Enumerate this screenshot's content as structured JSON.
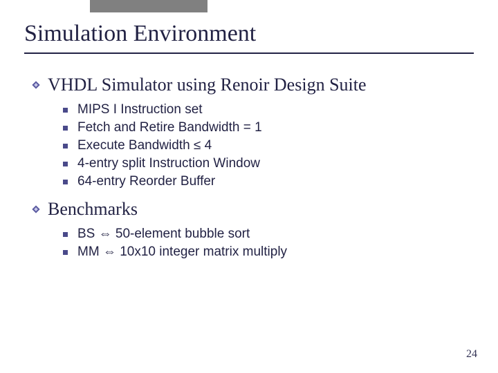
{
  "title": "Simulation Environment",
  "sections": [
    {
      "heading": "VHDL Simulator using Renoir Design Suite",
      "items": [
        "MIPS I Instruction set",
        "Fetch and Retire Bandwidth = 1",
        "Execute Bandwidth ≤ 4",
        "4-entry split Instruction Window",
        "64-entry Reorder Buffer"
      ]
    },
    {
      "heading": "Benchmarks",
      "items": [
        "BS ⇔ 50-element bubble sort",
        "MM ⇔ 10x10 integer matrix multiply"
      ]
    }
  ],
  "page_number": "24"
}
